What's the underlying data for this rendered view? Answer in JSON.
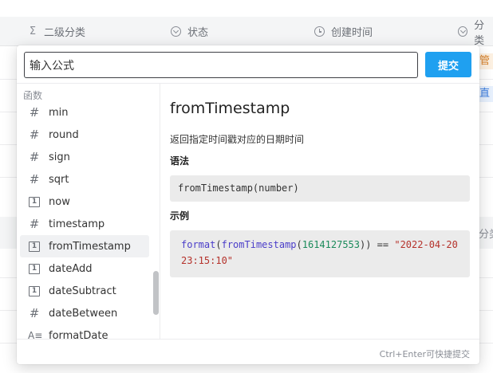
{
  "table": {
    "columns": [
      {
        "icon": "sigma-icon",
        "glyph": "Σ",
        "label": "二级分类"
      },
      {
        "icon": "chevron-circle-icon",
        "label": "状态"
      },
      {
        "icon": "clock-icon",
        "label": "创建时间"
      },
      {
        "icon": "chevron-circle-icon",
        "label": "分类"
      }
    ],
    "tag_orange": "管",
    "tag_blue": "直",
    "right_text": "分类"
  },
  "formula": {
    "input_value": "输入公式",
    "submit_label": "提交"
  },
  "functions": {
    "section_label": "函数",
    "items": [
      {
        "name": "min",
        "icon": "hash-icon"
      },
      {
        "name": "round",
        "icon": "hash-icon"
      },
      {
        "name": "sign",
        "icon": "hash-icon"
      },
      {
        "name": "sqrt",
        "icon": "hash-icon"
      },
      {
        "name": "now",
        "icon": "calendar-icon"
      },
      {
        "name": "timestamp",
        "icon": "hash-icon"
      },
      {
        "name": "fromTimestamp",
        "icon": "calendar-icon",
        "selected": true
      },
      {
        "name": "dateAdd",
        "icon": "calendar-icon"
      },
      {
        "name": "dateSubtract",
        "icon": "calendar-icon"
      },
      {
        "name": "dateBetween",
        "icon": "hash-icon"
      },
      {
        "name": "formatDate",
        "icon": "text-format-icon"
      }
    ]
  },
  "doc": {
    "title": "fromTimestamp",
    "description": "返回指定时间戳对应的日期时间",
    "syntax_heading": "语法",
    "syntax_code": "fromTimestamp(number)",
    "example_heading": "示例",
    "example": {
      "fn_outer": "format",
      "fn_inner": "fromTimestamp",
      "number": "1614127553",
      "operator": ")) == ",
      "string_line1": "\"2022-04-20",
      "string_line2": "23:15:10\""
    }
  },
  "footer": {
    "hint": "Ctrl+Enter可快捷提交"
  },
  "colors": {
    "accent": "#1fa0f0",
    "code_fn": "#4b3ec9",
    "code_num": "#1a8a5a",
    "code_str": "#b5322b"
  }
}
